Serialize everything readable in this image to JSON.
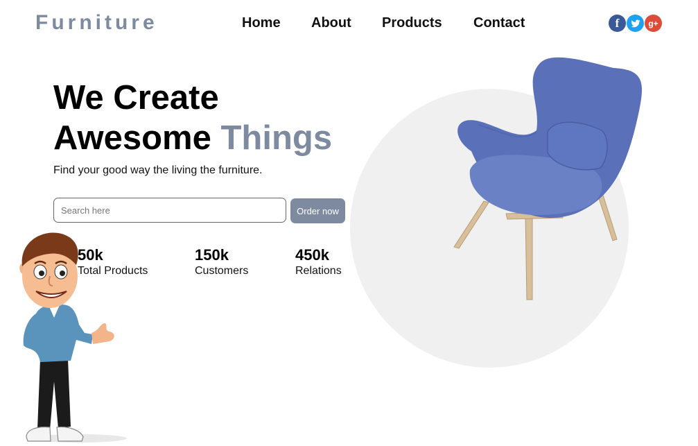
{
  "brand": {
    "name": "Furniture"
  },
  "nav": {
    "items": [
      "Home",
      "About",
      "Products",
      "Contact"
    ]
  },
  "social": {
    "facebook": "f",
    "twitter": "t",
    "google": "g+"
  },
  "hero": {
    "title_line1": "We Create",
    "title_line2_a": "Awesome",
    "title_line2_b": "Things",
    "subtitle": "Find your good way the living the furniture.",
    "search_placeholder": "Search here",
    "order_button": "Order now"
  },
  "stats": [
    {
      "value": "50k",
      "label": "Total Products"
    },
    {
      "value": "150k",
      "label": "Customers"
    },
    {
      "value": "450k",
      "label": "Relations"
    }
  ],
  "colors": {
    "accent": "#7d8aa0",
    "chair": "#5b72bb",
    "circle": "#f0f0f0"
  }
}
